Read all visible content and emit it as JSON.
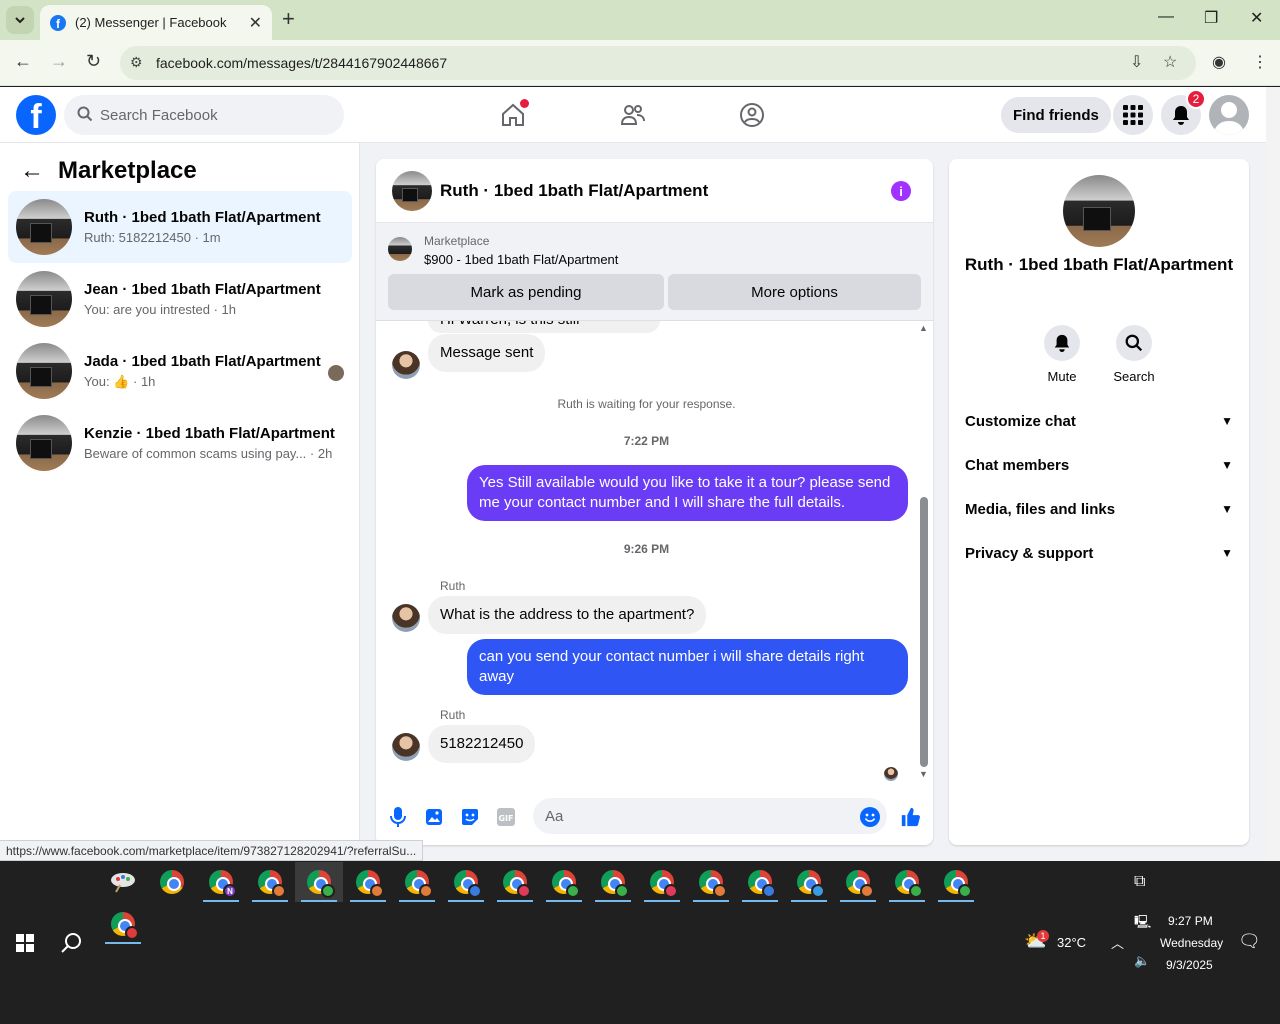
{
  "browser": {
    "tab_title": "(2) Messenger | Facebook",
    "url": "facebook.com/messages/t/2844167902448667",
    "status_url": "https://www.facebook.com/marketplace/item/973827128202941/?referralSu..."
  },
  "fb": {
    "search_placeholder": "Search Facebook",
    "find_friends": "Find friends",
    "notification_count": "2"
  },
  "sidebar": {
    "title": "Marketplace",
    "conversations": [
      {
        "name": "Ruth · 1bed 1bath Flat/Apartment",
        "preview": "Ruth: 5182212450 · 1m"
      },
      {
        "name": "Jean · 1bed 1bath Flat/Apartment",
        "preview": "You: are you intrested · 1h"
      },
      {
        "name": "Jada · 1bed 1bath Flat/Apartment",
        "preview_prefix": "You:",
        "preview_suffix": "· 1h"
      },
      {
        "name": "Kenzie · 1bed 1bath Flat/Apartment",
        "preview": "Beware of common scams using pay...",
        "preview_time": "· 2h"
      }
    ]
  },
  "chat": {
    "title": "Ruth · 1bed 1bath Flat/Apartment",
    "banner_label": "Marketplace",
    "banner_item": "$900 - 1bed 1bath Flat/Apartment",
    "mark_pending": "Mark as pending",
    "more_options": "More options",
    "clipped_message": "Hi Warren, is this still available?",
    "message_sent": "Message sent",
    "waiting_note": "Ruth is waiting for your response.",
    "time1": "7:22 PM",
    "out1": "Yes Still available would you like to take it a tour? please send me your contact number and I will share the full details.",
    "time2": "9:26 PM",
    "sender1": "Ruth",
    "in1": "What is the address to the apartment?",
    "out2": "can you send your contact number i will share details right away",
    "sender2": "Ruth",
    "in2": "5182212450",
    "input_placeholder": "Aa"
  },
  "details": {
    "name": "Ruth · 1bed 1bath Flat/Apartment",
    "mute": "Mute",
    "search": "Search",
    "rows": [
      "Customize chat",
      "Chat members",
      "Media, files and links",
      "Privacy & support"
    ]
  },
  "taskbar": {
    "weather_temp": "32°C",
    "weather_alert": "1",
    "time": "9:27 PM",
    "day": "Wednesday",
    "date": "9/3/2025"
  },
  "colors": {
    "fb_blue": "#0866ff",
    "outgoing_purple": "#6b3cf5",
    "outgoing_blue": "#2f55f5",
    "info_purple": "#a033ff"
  }
}
